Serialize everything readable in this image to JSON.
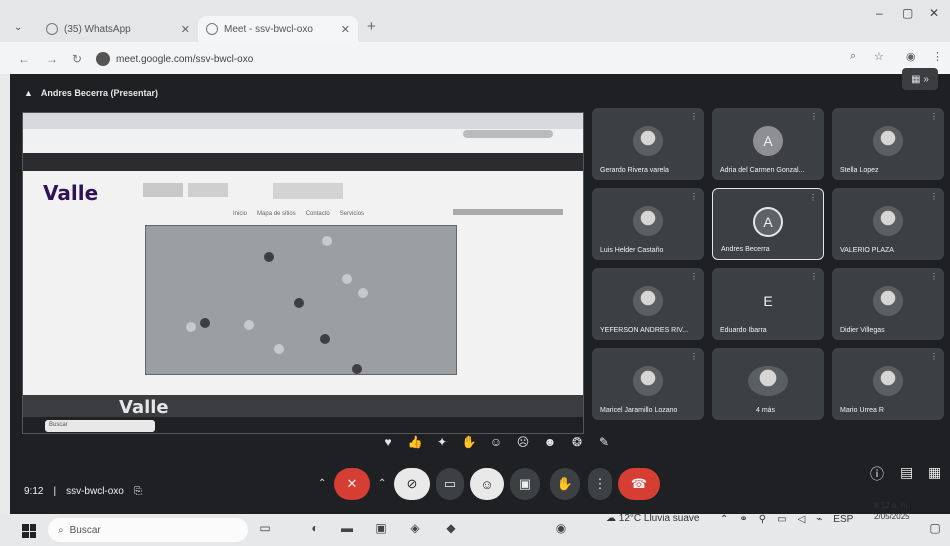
{
  "browser": {
    "tabs": [
      {
        "label": "(35) WhatsApp"
      },
      {
        "label": "Meet - ssv-bwcl-oxo"
      }
    ],
    "url": "meet.google.com/ssv-bwcl-oxo",
    "new_tab": "+"
  },
  "meet": {
    "presenter_label": "Andres Becerra (Presentar)",
    "meeting_code": "ssv-bwcl-oxo",
    "time": "9:12",
    "participants": [
      {
        "name": "Gerardo Rivera varela",
        "avatar": ""
      },
      {
        "name": "Adria del Carmen Gonzal...",
        "avatar": "A"
      },
      {
        "name": "Stella Lopez",
        "avatar": ""
      },
      {
        "name": "Luis Helder Castaño",
        "avatar": ""
      },
      {
        "name": "Andres Becerra",
        "avatar": "A"
      },
      {
        "name": "VALERIO PLAZA",
        "avatar": ""
      },
      {
        "name": "YEFERSON ANDRES RIV...",
        "avatar": ""
      },
      {
        "name": "Eduardo Ibarra",
        "avatar": "E"
      },
      {
        "name": "Didier Villegas",
        "avatar": ""
      },
      {
        "name": "Maricel Jaramillo Lozano",
        "avatar": ""
      },
      {
        "name": "4 más",
        "avatar": ""
      },
      {
        "name": "Mario Urrea R",
        "avatar": ""
      }
    ],
    "shared_screen": {
      "logo": "Valle",
      "footer_logo": "Valle",
      "menu": [
        "Inicio",
        "Mapa de sitios",
        "Contacto",
        "Servicios"
      ],
      "search_placeholder": "Buscar"
    }
  },
  "taskbar": {
    "search_placeholder": "Buscar",
    "weather": "12°C  Lluvia suave",
    "language": "ESP",
    "clock_time": "9:12 a. m.",
    "clock_date": "2/05/2025"
  },
  "colors": {
    "meet_bg": "#1f2023",
    "tile_bg": "#3c4043",
    "hangup": "#d63e33"
  }
}
